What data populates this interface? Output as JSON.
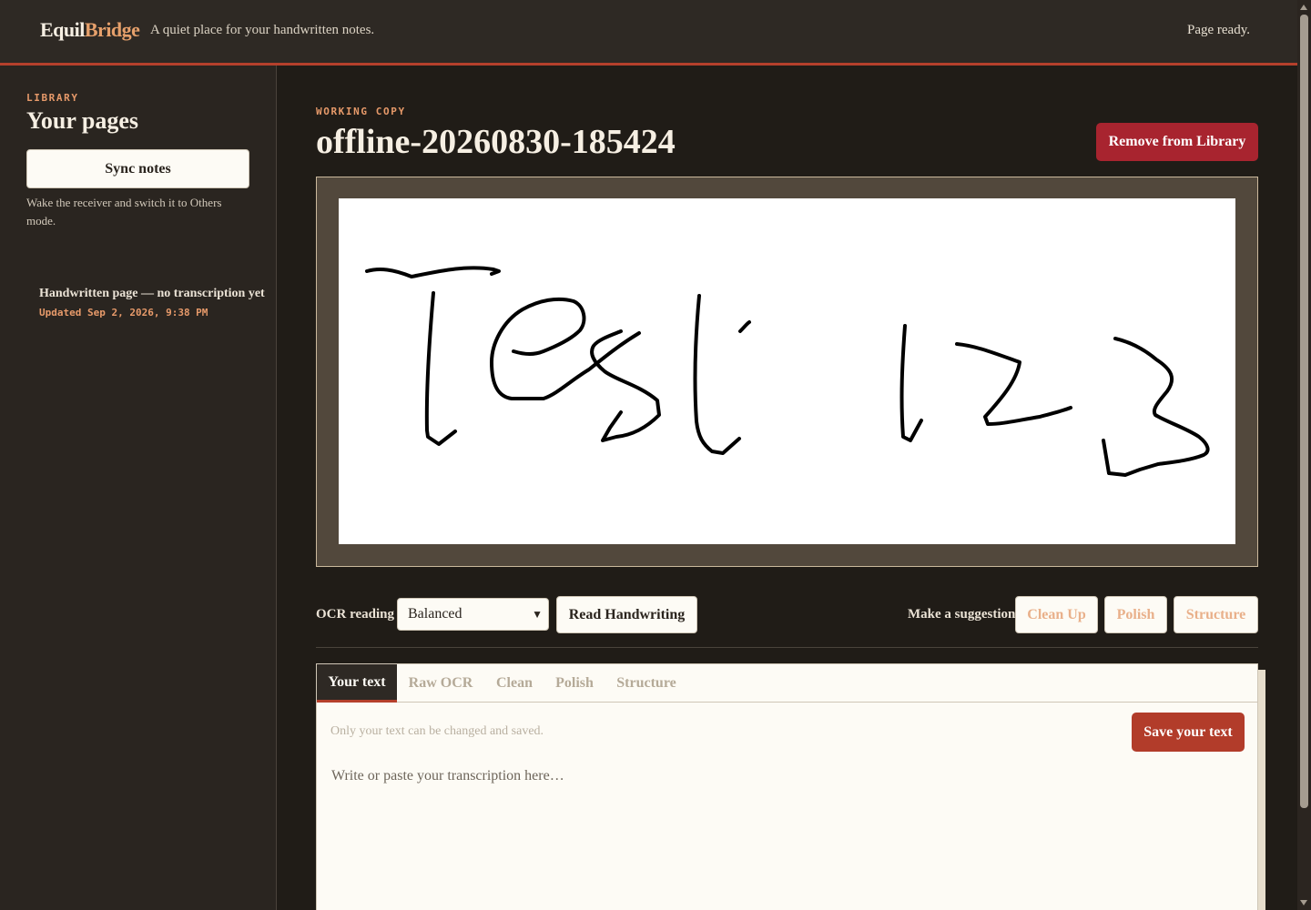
{
  "header": {
    "brand_part1": "Equil",
    "brand_part2": "Bridge",
    "tagline": "A quiet place for your handwritten notes.",
    "status": "Page ready."
  },
  "sidebar": {
    "eyebrow": "LIBRARY",
    "title": "Your pages",
    "sync_label": "Sync notes",
    "sync_hint": "Wake the receiver and switch it to Others mode.",
    "pages": [
      {
        "title": "Handwritten page — no transcription yet",
        "updated": "Updated Sep 2, 2026, 9:38 PM"
      }
    ]
  },
  "main": {
    "eyebrow": "WORKING COPY",
    "title": "offline-20260830-185424",
    "remove_label": "Remove from Library",
    "canvas": {
      "icon": "handwriting-canvas",
      "handwriting": "Test 123"
    },
    "ocr": {
      "label": "OCR reading",
      "selected": "Balanced",
      "read_label": "Read Handwriting"
    },
    "suggest": {
      "label": "Make a suggestion",
      "buttons": [
        "Clean Up",
        "Polish",
        "Structure"
      ]
    },
    "tabs": [
      "Your text",
      "Raw OCR",
      "Clean",
      "Polish",
      "Structure"
    ],
    "editor": {
      "note": "Only your text can be changed and saved.",
      "save_label": "Save your text",
      "placeholder": "Write or paste your transcription here…"
    }
  },
  "colors": {
    "accent": "#b5402c",
    "brand_accent": "#e6a06b",
    "danger": "#a8242f",
    "background": "#201c17"
  }
}
